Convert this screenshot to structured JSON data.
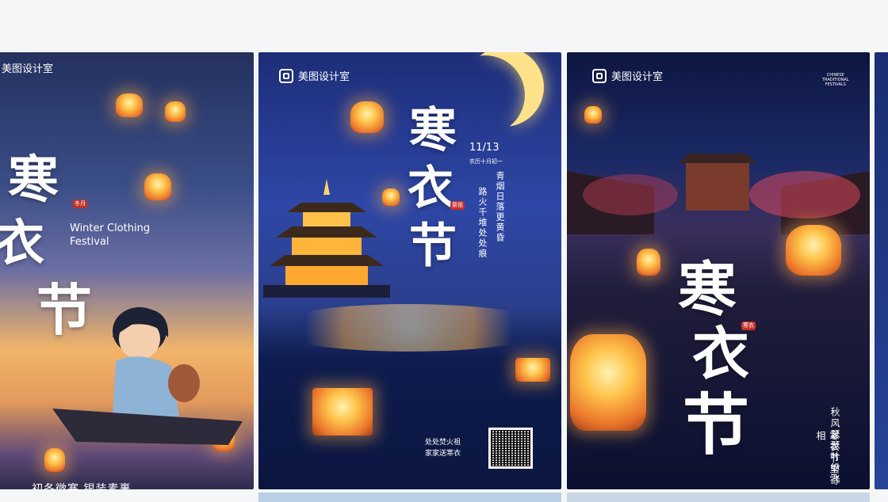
{
  "brand_name": "美图设计室",
  "posters": [
    {
      "title_chars": [
        "寒",
        "衣",
        "节"
      ],
      "seal_text": "冬月",
      "en_title": [
        "Winter Clothing",
        "Festival"
      ],
      "bottom_text": "初冬微寒  银装素裹"
    },
    {
      "title_chars": [
        "寒",
        "衣",
        "节"
      ],
      "seal_text": "祭祖",
      "date": "11/13",
      "lunar_date": "农历十月初一",
      "poem": [
        "青烟日落更黄昏",
        "路火千堆处处痕"
      ],
      "bottom_text": [
        "处处焚火祖",
        "家家送寒衣"
      ]
    },
    {
      "corner_text": [
        "CHINESE",
        "TRADITIONAL",
        "FESTIVALS"
      ],
      "title_chars": [
        "寒",
        "衣",
        "节"
      ],
      "seal_text": "寒衣",
      "poem": [
        "秋风瑟瑟叶纷飞",
        "寒衣节里寄相"
      ]
    }
  ]
}
